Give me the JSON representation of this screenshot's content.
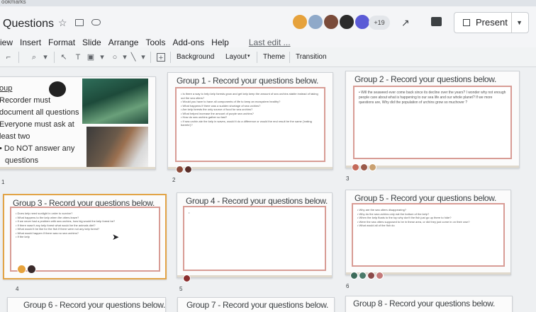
{
  "bookmarks": {
    "label": "ookmarks"
  },
  "header": {
    "title": "Questions",
    "menu": [
      "iew",
      "Insert",
      "Format",
      "Slide",
      "Arrange",
      "Tools",
      "Add-ons",
      "Help"
    ],
    "last_edit": "Last edit ...",
    "collaborator_count": "+19",
    "present_label": "Present",
    "avatar_colors": [
      "#e6a23c",
      "#6c8ebf",
      "#7a4b3a",
      "#2b2b2b",
      "#5b5bd6"
    ]
  },
  "toolbar": {
    "background_label": "Background",
    "layout_label": "Layout",
    "theme_label": "Theme",
    "transition_label": "Transition"
  },
  "slides": [
    {
      "number": "1",
      "lines": [
        "oup",
        "Recorder must",
        "document all questions",
        "Everyone must ask at",
        "least two",
        "• Do NOT answer any",
        "questions"
      ]
    },
    {
      "number": "2",
      "title": "Group 1 - Record your questions below.",
      "bullets": [
        "Is there a way to help kelp forests grow and get kelp keep the amount of sea urchins stable instead of taking out the sea otters?",
        "Would you have to have all components of life to keep an ecosystem healthy?",
        "What happens if there was a sudden shortage of sea urchins?",
        "Are kelp forests the only source of food for sea urchins?",
        "What helped increase the amount of purple sea urchins?",
        "How do sea urchins gather so fast?",
        "If sea urchin ate the kelp in waves, would it do a difference or would the end result be the same ('eating barrels')?"
      ]
    },
    {
      "number": "3",
      "title": "Group 2 - Record your questions below.",
      "bullets": [
        "Will the seaweed ever come back since its decline over the years? I wonder why not enough people care about what is happening to our sea life and our whole planet? If we more questions are, Why did the population of urchins grow so muchover ?"
      ]
    },
    {
      "number": "4",
      "title": "Group 3 - Record your questions below.",
      "bullets": [
        "Does kelp need sunlight in order to survive?",
        "What happens to the kelp when the otters leave?",
        "If we never had a problem with sea urchins, how big would the kelp forest be?",
        "If there wasn't any kelp forest what would be the animals diet?",
        "What would it be like for the fish if there were not any kelp forest?",
        "What would happen if there was no sea urchins?",
        "If the kelp"
      ]
    },
    {
      "number": "5",
      "title": "Group 4 - Record your questions below.",
      "bullets": [
        ""
      ]
    },
    {
      "number": "6",
      "title": "Group 5 - Record your questions below.",
      "bullets": [
        "Why are the sea otters disappearing?",
        "Why do the sea urchins only eat the bottom of the kelp?",
        "When the kelp floats to the top why don't the fish just go up there to hide?",
        "Were the sea otters supposed to be in these area, or did they just come in on their own?",
        "What would all of the fish do"
      ]
    },
    {
      "title": "Group 6 - Record your questions below."
    },
    {
      "title": "Group 7 - Record your questions below."
    },
    {
      "title": "Group 8 - Record your questions below."
    }
  ]
}
